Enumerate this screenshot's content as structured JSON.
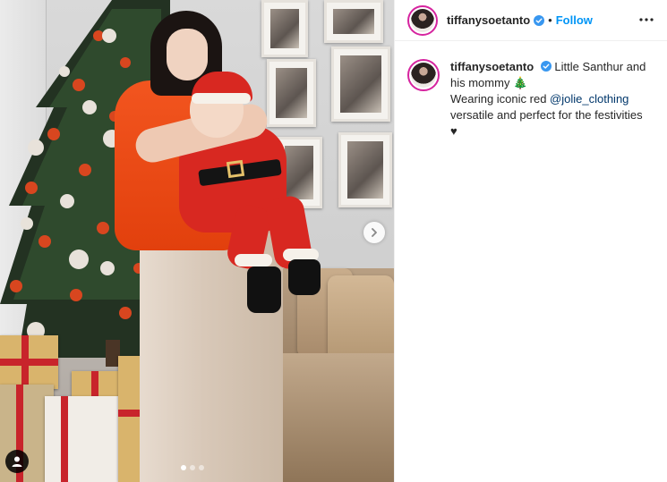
{
  "header": {
    "username": "tiffanysoetanto",
    "separator": "•",
    "follow_label": "Follow",
    "more_icon": "ellipsis-icon"
  },
  "caption": {
    "username": "tiffanysoetanto",
    "line1": "Little Santhur and his mommy",
    "tree_emoji": "🎄",
    "line2_prefix": "Wearing iconic red ",
    "mention": "@jolie_clothing",
    "line3": "versatile and perfect for the festivities",
    "heart": "♥"
  },
  "carousel": {
    "total": 3,
    "active_index": 0,
    "next_icon": "chevron-right-icon",
    "tag_icon": "user-tag-icon"
  },
  "colors": {
    "link_blue": "#0095f6",
    "mention_blue": "#00376b",
    "text": "#262626",
    "verified_blue": "#3897f0",
    "story_ring": "#d6249f"
  }
}
